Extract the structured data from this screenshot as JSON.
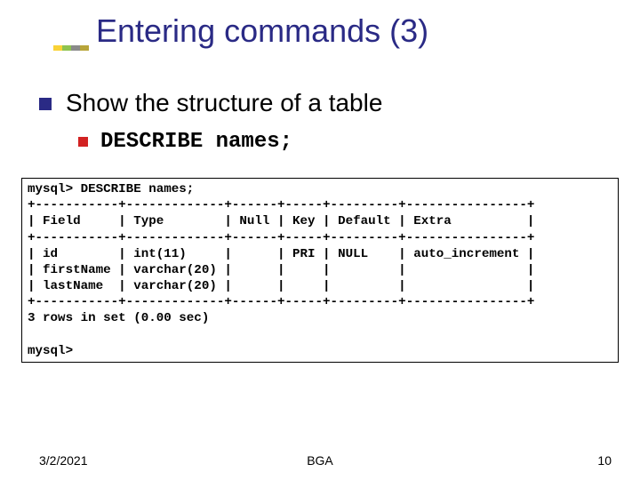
{
  "title": "Entering commands (3)",
  "bullet_lvl1": "Show the structure of a table",
  "bullet_lvl2": "DESCRIBE names;",
  "code": "mysql> DESCRIBE names;\n+-----------+-------------+------+-----+---------+----------------+\n| Field     | Type        | Null | Key | Default | Extra          |\n+-----------+-------------+------+-----+---------+----------------+\n| id        | int(11)     |      | PRI | NULL    | auto_increment |\n| firstName | varchar(20) |      |     |         |                |\n| lastName  | varchar(20) |      |     |         |                |\n+-----------+-------------+------+-----+---------+----------------+\n3 rows in set (0.00 sec)\n\nmysql>",
  "footer": {
    "date": "3/2/2021",
    "center": "BGA",
    "page": "10"
  },
  "chart_data": {
    "type": "table",
    "columns": [
      "Field",
      "Type",
      "Null",
      "Key",
      "Default",
      "Extra"
    ],
    "rows": [
      [
        "id",
        "int(11)",
        "",
        "PRI",
        "NULL",
        "auto_increment"
      ],
      [
        "firstName",
        "varchar(20)",
        "",
        "",
        "",
        ""
      ],
      [
        "lastName",
        "varchar(20)",
        "",
        "",
        "",
        ""
      ]
    ],
    "summary": "3 rows in set (0.00 sec)",
    "prompt": "mysql>",
    "command": "DESCRIBE names;"
  }
}
